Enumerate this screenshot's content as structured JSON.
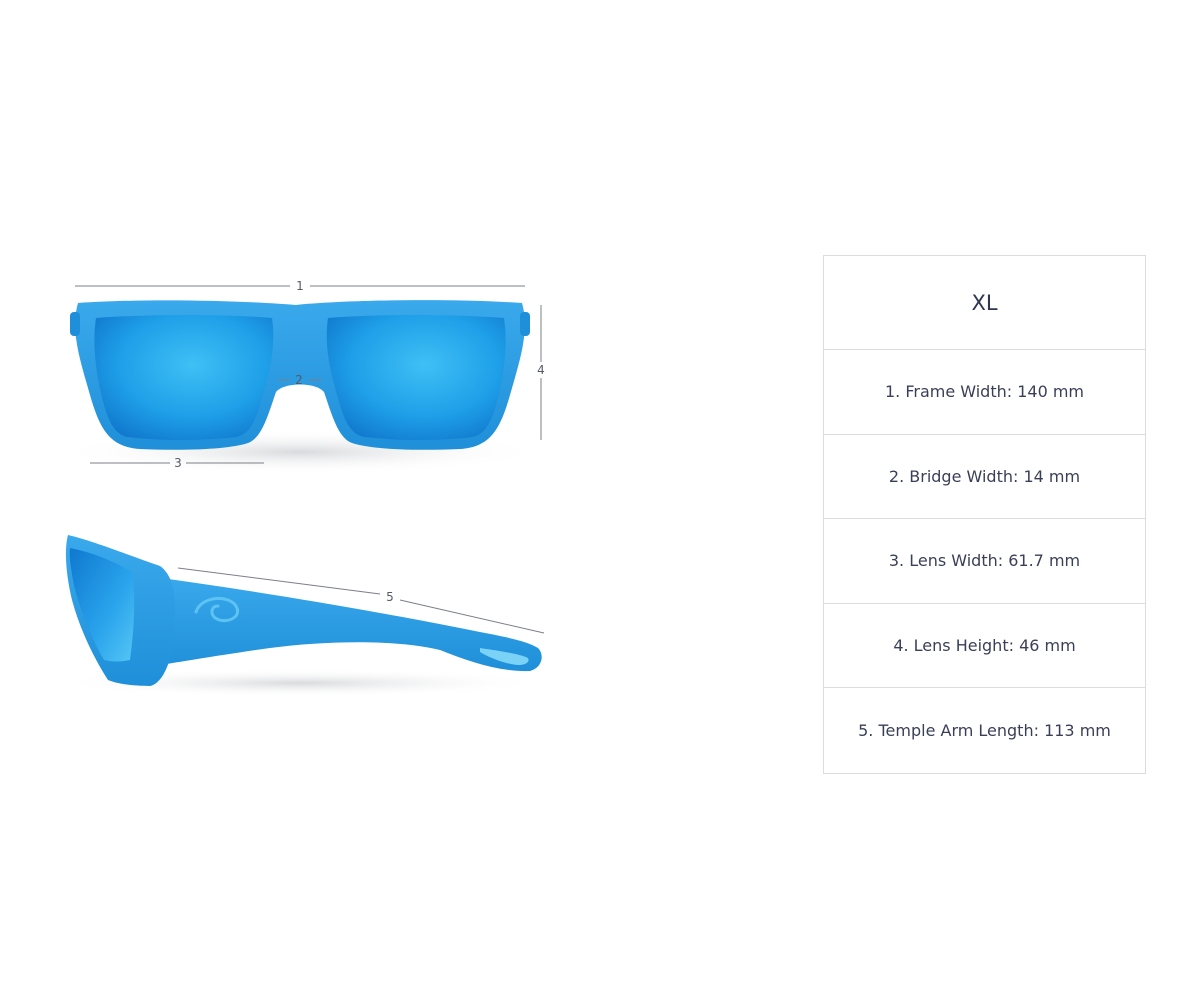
{
  "diagram": {
    "labels": [
      "1",
      "2",
      "3",
      "4",
      "5"
    ],
    "colors": {
      "frame": "#2a9de0",
      "frame_dark": "#1a86cf",
      "lens": "#1e9fe8",
      "measure_line": "#7a7f88"
    }
  },
  "table": {
    "size": "XL",
    "rows": [
      "1. Frame Width: 140 mm",
      "2. Bridge Width: 14 mm",
      "3. Lens Width: 61.7 mm",
      "4. Lens Height: 46 mm",
      "5. Temple Arm Length: 113 mm"
    ]
  }
}
